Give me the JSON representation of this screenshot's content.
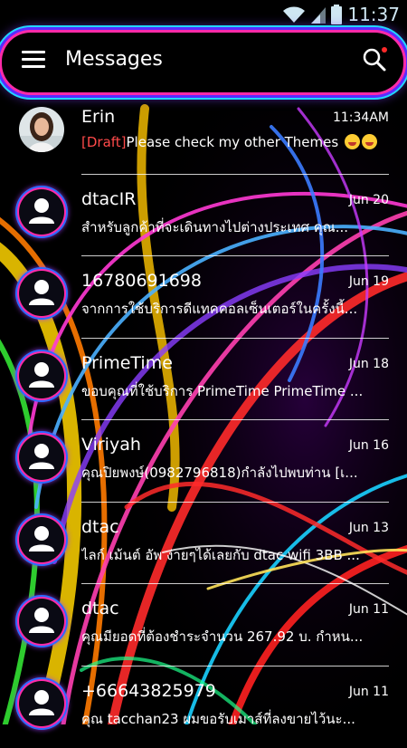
{
  "status_bar": {
    "time": "11:37"
  },
  "app_bar": {
    "title": "Messages"
  },
  "conversations": [
    {
      "name": "Erin",
      "time": "11:34AM",
      "draft_label": "[Draft]",
      "snippet": "Please check my other Themes",
      "avatar": "photo"
    },
    {
      "name": "dtacIR",
      "time": "Jun 20",
      "snippet": "สำหรับลูกค้าที่จะเดินทางไปต่างประเทศ คุณ...",
      "avatar": "person-icon"
    },
    {
      "name": "16780691698",
      "time": "Jun 19",
      "snippet": "จากการใช้บริการดีแทคคอลเซ็นเตอร์ในครั้งนี้...",
      "avatar": "person-icon"
    },
    {
      "name": "PrimeTime",
      "time": "Jun 18",
      "snippet": "ขอบคุณที่ใช้บริการ PrimeTime PrimeTime ...",
      "avatar": "person-icon"
    },
    {
      "name": "Viriyah",
      "time": "Jun 16",
      "snippet": "คุณปิยพงษ์(0982796818)กำลังไปพบท่าน [เ...",
      "avatar": "person-icon"
    },
    {
      "name": "dtac",
      "time": "Jun 13",
      "snippet": "ไลก์ เม้นต์ อัพ ง่ายๆได้เลยกับ dtac wifi 3BB ...",
      "avatar": "person-icon"
    },
    {
      "name": "dtac",
      "time": "Jun 11",
      "snippet": "คุณมียอดที่ต้องชำระจำนวน 267.92 บ. กำหน...",
      "avatar": "person-icon"
    },
    {
      "name": "+66643825979",
      "time": "Jun 11",
      "snippet": "คุณ tacchan23 ผมขอรับเมาส์ที่ลงขายไว้นะ...",
      "avatar": "person-icon"
    }
  ]
}
